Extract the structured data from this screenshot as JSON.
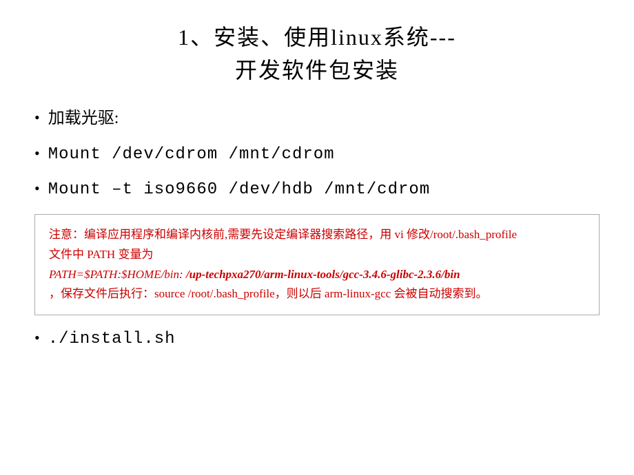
{
  "title": {
    "line1": "1、安装、使用linux系统---",
    "line2": "开发软件包安装"
  },
  "bullets": [
    {
      "id": "b1",
      "type": "chinese",
      "text": "加载光驱:"
    },
    {
      "id": "b2",
      "type": "mono",
      "text": "Mount    /dev/cdrom   /mnt/cdrom"
    },
    {
      "id": "b3",
      "type": "mono",
      "text": "Mount –t iso9660 /dev/hdb  /mnt/cdrom"
    }
  ],
  "notice": {
    "line1": "注意：编译应用程序和编译内核前,需要先设定编译器搜索路径，用 vi 修改/root/.bash_profile",
    "line2": "文件中 PATH 变量为",
    "line3_prefix": "PATH=$PATH:$HOME/bin: ",
    "line3_bold": "/up-techpxa270/arm-linux-tools/gcc-3.4.6-glibc-2.3.6/bin",
    "line4": "，保存文件后执行：source /root/.bash_profile，则以后 arm-linux-gcc 会被自动搜索到。"
  },
  "bottom_bullet": {
    "text": "./install.sh"
  }
}
